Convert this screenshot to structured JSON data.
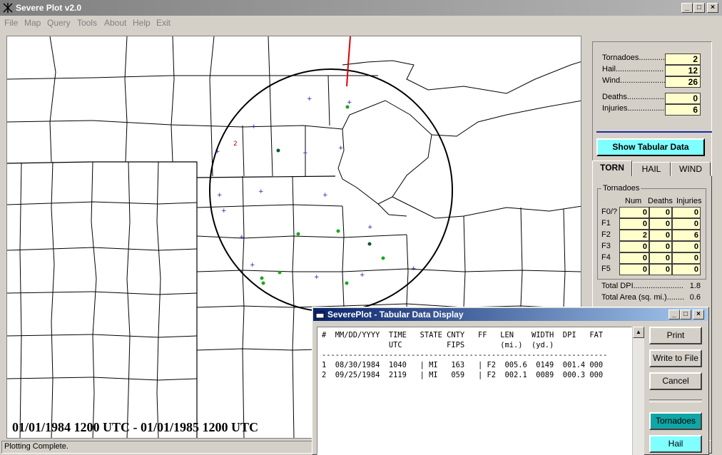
{
  "window": {
    "title": "Severe Plot v2.0"
  },
  "menu": [
    "File",
    "Map",
    "Query",
    "Tools",
    "About",
    "Help",
    "Exit"
  ],
  "map": {
    "date_range": "01/01/1984 1200 UTC - 01/01/1985 1200 UTC",
    "marker_label": "2"
  },
  "status": "Plotting Complete.",
  "summary": {
    "tornadoes_label": "Tornadoes..............",
    "tornadoes": "2",
    "hail_label": "Hail......................",
    "hail": "12",
    "wind_label": "Wind.....................",
    "wind": "26",
    "deaths_label": "Deaths...................",
    "deaths": "0",
    "injuries_label": "Injuries...................",
    "injuries": "6"
  },
  "show_tabular_label": "Show Tabular Data",
  "tabs": [
    "TORN",
    "HAIL",
    "WIND"
  ],
  "tornado_table": {
    "group_title": "Tornadoes",
    "headers": [
      "Num",
      "Deaths",
      "Injuries"
    ],
    "rows": [
      {
        "label": "F0/?",
        "num": "0",
        "deaths": "0",
        "injuries": "0"
      },
      {
        "label": "F1",
        "num": "0",
        "deaths": "0",
        "injuries": "0"
      },
      {
        "label": "F2",
        "num": "2",
        "deaths": "0",
        "injuries": "6"
      },
      {
        "label": "F3",
        "num": "0",
        "deaths": "0",
        "injuries": "0"
      },
      {
        "label": "F4",
        "num": "0",
        "deaths": "0",
        "injuries": "0"
      },
      {
        "label": "F5",
        "num": "0",
        "deaths": "0",
        "injuries": "0"
      }
    ],
    "total_dpi_label": "Total DPI.......................",
    "total_dpi": "1.8",
    "total_area_label": "Total Area (sq. mi.)........",
    "total_area": "0.6"
  },
  "dialog": {
    "title": "SeverePlot - Tabular Data Display",
    "lines": [
      "#  MM/DD/YYYY  TIME   STATE CNTY   FF   LEN    WIDTH  DPI   FAT",
      "               UTC          FIPS        (mi.)  (yd.)",
      "----------------------------------------------------------------",
      "1  08/30/1984  1040   | MI   163   | F2  005.6  0149  001.4 000",
      "2  09/25/1984  2119   | MI   059   | F2  002.1  0089  000.3 000"
    ],
    "buttons": {
      "print": "Print",
      "write": "Write to File",
      "cancel": "Cancel"
    },
    "tornadoes_btn": "Tornadoes",
    "hail_btn": "Hail",
    "colors": {
      "tornadoes": "#11a5a5",
      "hail": "#7fffff"
    }
  }
}
